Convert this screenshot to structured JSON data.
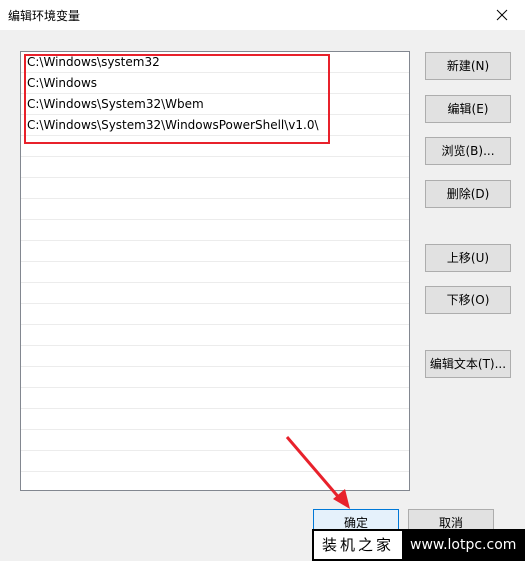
{
  "window": {
    "title": "编辑环境变量"
  },
  "path_entries": [
    "C:\\Windows\\system32",
    "C:\\Windows",
    "C:\\Windows\\System32\\Wbem",
    "C:\\Windows\\System32\\WindowsPowerShell\\v1.0\\"
  ],
  "buttons": {
    "new": "新建(N)",
    "edit": "编辑(E)",
    "browse": "浏览(B)...",
    "delete": "删除(D)",
    "move_up": "上移(U)",
    "move_down": "下移(O)",
    "edit_text": "编辑文本(T)...",
    "ok": "确定",
    "cancel": "取消"
  },
  "watermark": {
    "brand": "装机之家",
    "url": "www.lotpc.com"
  },
  "colors": {
    "highlight": "#e8212b",
    "accent": "#0078d7"
  }
}
